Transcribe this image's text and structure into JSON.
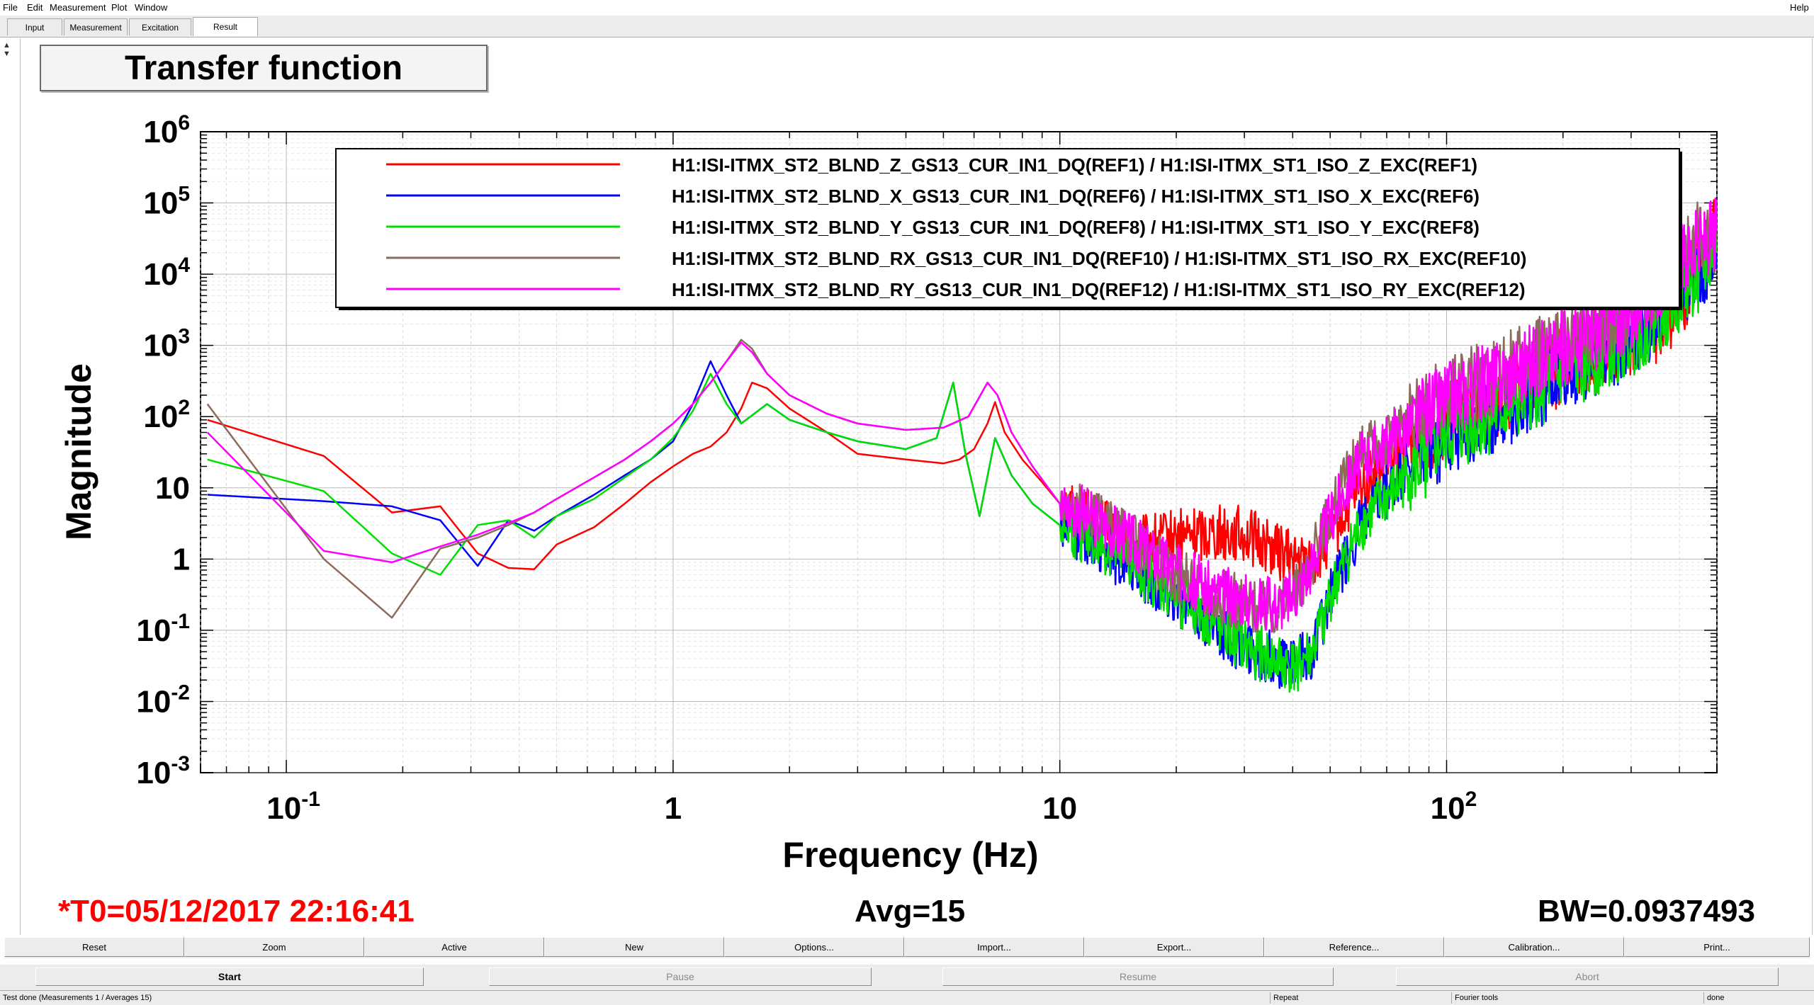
{
  "menu": {
    "file": "File",
    "edit": "Edit",
    "measurement": "Measurement",
    "plot": "Plot",
    "window": "Window",
    "help": "Help"
  },
  "tabs": [
    "Input",
    "Measurement",
    "Excitation",
    "Result"
  ],
  "active_tab": "Result",
  "plot_title": "Transfer function",
  "info": {
    "t0": "*T0=05/12/2017 22:16:41",
    "avg": "Avg=15",
    "bw": "BW=0.0937493"
  },
  "buttons": [
    "Reset",
    "Zoom",
    "Active",
    "New",
    "Options...",
    "Import...",
    "Export...",
    "Reference...",
    "Calibration...",
    "Print..."
  ],
  "run_buttons": [
    "Start",
    "Pause",
    "Resume",
    "Abort"
  ],
  "status": {
    "message": "Test done (Measurements 1 / Averages 15)",
    "repeat": "Repeat",
    "tool": "Fourier tools",
    "state": "done"
  },
  "colors": {
    "accent_red": "#ff0000",
    "series_red": "#ff0000",
    "series_blue": "#0000ff",
    "series_green": "#00e000",
    "series_brown": "#8c6a5c",
    "series_magenta": "#ff00ff"
  },
  "chart_data": {
    "type": "line",
    "xscale": "log",
    "yscale": "log",
    "xlim": [
      0.06,
      500
    ],
    "ylim": [
      0.001,
      1000000
    ],
    "xlabel": "Frequency (Hz)",
    "ylabel": "Magnitude",
    "xticks": [
      0.1,
      1,
      10,
      100
    ],
    "xtick_labels": [
      {
        "base": "10",
        "exp": "-1"
      },
      {
        "base": "1",
        "exp": ""
      },
      {
        "base": "10",
        "exp": ""
      },
      {
        "base": "10",
        "exp": "2"
      }
    ],
    "yticks": [
      0.001,
      0.01,
      0.1,
      1,
      10,
      100,
      1000,
      10000,
      100000,
      1000000
    ],
    "ytick_labels": [
      {
        "base": "10",
        "exp": "-3"
      },
      {
        "base": "10",
        "exp": "-2"
      },
      {
        "base": "10",
        "exp": "-1"
      },
      {
        "base": "1",
        "exp": ""
      },
      {
        "base": "10",
        "exp": ""
      },
      {
        "base": "10",
        "exp": "2"
      },
      {
        "base": "10",
        "exp": "3"
      },
      {
        "base": "10",
        "exp": "4"
      },
      {
        "base": "10",
        "exp": "5"
      },
      {
        "base": "10",
        "exp": "6"
      }
    ],
    "grid": true,
    "legend_position": "top",
    "series": [
      {
        "name": "H1:ISI-ITMX_ST2_BLND_Z_GS13_CUR_IN1_DQ(REF1) / H1:ISI-ITMX_ST1_ISO_Z_EXC(REF1)",
        "color": "#ff0000",
        "x": [
          0.0625,
          0.125,
          0.1875,
          0.25,
          0.3125,
          0.375,
          0.4375,
          0.5,
          0.625,
          0.75,
          0.875,
          1.0,
          1.125,
          1.25,
          1.375,
          1.5,
          1.6,
          1.75,
          2.0,
          2.5,
          3.0,
          4.0,
          5.0,
          5.5,
          6.0,
          6.5,
          6.8,
          7.2,
          8.0,
          9.0,
          10.0,
          12.0,
          15.0,
          20.0,
          25.0,
          30.0,
          35.0,
          40.0,
          45.0,
          50.0,
          60.0,
          80.0,
          100.0,
          150.0,
          200.0,
          300.0,
          400.0,
          450.0,
          500.0
        ],
        "y": [
          90,
          28,
          4.5,
          5.5,
          1.2,
          0.75,
          0.72,
          1.6,
          2.8,
          6,
          12,
          20,
          30,
          38,
          60,
          130,
          300,
          250,
          130,
          60,
          30,
          25,
          22,
          25,
          35,
          80,
          160,
          60,
          25,
          12,
          6,
          4,
          1.5,
          2,
          2.5,
          2.2,
          1.5,
          1,
          0.8,
          2,
          10,
          40,
          80,
          250,
          500,
          1200,
          3000,
          20000,
          50000
        ]
      },
      {
        "name": "H1:ISI-ITMX_ST2_BLND_X_GS13_CUR_IN1_DQ(REF6) / H1:ISI-ITMX_ST1_ISO_X_EXC(REF6)",
        "color": "#0000ff",
        "x": [
          0.0625,
          0.125,
          0.1875,
          0.25,
          0.3125,
          0.375,
          0.4375,
          0.5,
          0.625,
          0.75,
          0.875,
          1.0,
          1.125,
          1.25,
          1.375,
          1.5,
          1.75,
          2.0,
          2.5,
          3.0,
          4.0,
          4.8,
          5.3,
          5.7,
          6.2,
          6.8,
          7.5,
          8.5,
          10.0,
          12.0,
          15.0,
          20.0,
          25.0,
          30.0,
          35.0,
          40.0,
          45.0,
          50.0,
          60.0,
          80.0,
          100.0,
          150.0,
          200.0,
          300.0,
          400.0,
          500.0
        ],
        "y": [
          8,
          6.5,
          5.5,
          3.5,
          0.8,
          3.5,
          2.5,
          4,
          8,
          15,
          25,
          45,
          150,
          600,
          200,
          80,
          150,
          90,
          60,
          45,
          35,
          50,
          300,
          30,
          4,
          50,
          15,
          6,
          3,
          2,
          0.8,
          0.3,
          0.12,
          0.06,
          0.04,
          0.03,
          0.05,
          0.3,
          3,
          20,
          50,
          150,
          400,
          1200,
          5000,
          20000
        ]
      },
      {
        "name": "H1:ISI-ITMX_ST2_BLND_Y_GS13_CUR_IN1_DQ(REF8) / H1:ISI-ITMX_ST1_ISO_Y_EXC(REF8)",
        "color": "#00e000",
        "x": [
          0.0625,
          0.125,
          0.1875,
          0.25,
          0.3125,
          0.375,
          0.4375,
          0.5,
          0.625,
          0.75,
          0.875,
          1.0,
          1.125,
          1.25,
          1.375,
          1.5,
          1.75,
          2.0,
          2.5,
          3.0,
          4.0,
          4.8,
          5.3,
          5.7,
          6.2,
          6.8,
          7.5,
          8.5,
          10.0,
          12.0,
          15.0,
          20.0,
          25.0,
          30.0,
          35.0,
          40.0,
          45.0,
          50.0,
          60.0,
          80.0,
          100.0,
          150.0,
          200.0,
          300.0,
          400.0,
          500.0
        ],
        "y": [
          25,
          9,
          1.2,
          0.6,
          3,
          3.5,
          2,
          4,
          7,
          14,
          25,
          50,
          120,
          400,
          150,
          80,
          150,
          90,
          60,
          45,
          35,
          50,
          300,
          30,
          4,
          50,
          15,
          6,
          3,
          2,
          0.9,
          0.3,
          0.12,
          0.06,
          0.04,
          0.03,
          0.05,
          0.3,
          3,
          15,
          50,
          150,
          400,
          1200,
          5000,
          20000
        ]
      },
      {
        "name": "H1:ISI-ITMX_ST2_BLND_RX_GS13_CUR_IN1_DQ(REF10) / H1:ISI-ITMX_ST1_ISO_RX_EXC(REF10)",
        "color": "#8c6a5c",
        "x": [
          0.0625,
          0.125,
          0.1875,
          0.25,
          0.3125,
          0.375,
          0.4375,
          0.5,
          0.625,
          0.75,
          0.875,
          1.0,
          1.125,
          1.25,
          1.375,
          1.5,
          1.6,
          1.75,
          2.0,
          2.5,
          3.0,
          4.0,
          5.0,
          5.8,
          6.5,
          6.9,
          7.5,
          8.5,
          10.0,
          12.0,
          15.0,
          20.0,
          25.0,
          30.0,
          35.0,
          40.0,
          45.0,
          50.0,
          60.0,
          80.0,
          100.0,
          150.0,
          200.0,
          300.0,
          400.0,
          500.0
        ],
        "y": [
          150,
          1,
          0.15,
          1.4,
          2,
          3,
          4.5,
          7,
          14,
          25,
          45,
          80,
          150,
          300,
          600,
          1200,
          900,
          400,
          200,
          110,
          80,
          65,
          70,
          100,
          300,
          200,
          60,
          20,
          6,
          4,
          2,
          0.6,
          0.3,
          0.25,
          0.2,
          0.3,
          1,
          5,
          30,
          80,
          200,
          500,
          1000,
          3000,
          20000,
          50000
        ]
      },
      {
        "name": "H1:ISI-ITMX_ST2_BLND_RY_GS13_CUR_IN1_DQ(REF12) / H1:ISI-ITMX_ST1_ISO_RY_EXC(REF12)",
        "color": "#ff00ff",
        "x": [
          0.0625,
          0.125,
          0.1875,
          0.25,
          0.3125,
          0.375,
          0.4375,
          0.5,
          0.625,
          0.75,
          0.875,
          1.0,
          1.125,
          1.25,
          1.375,
          1.5,
          1.6,
          1.75,
          2.0,
          2.5,
          3.0,
          4.0,
          5.0,
          5.8,
          6.5,
          6.9,
          7.5,
          8.5,
          10.0,
          12.0,
          15.0,
          20.0,
          25.0,
          30.0,
          35.0,
          40.0,
          45.0,
          50.0,
          60.0,
          80.0,
          100.0,
          150.0,
          200.0,
          300.0,
          400.0,
          500.0
        ],
        "y": [
          60,
          1.3,
          0.9,
          1.5,
          2.2,
          3.2,
          4.5,
          7,
          14,
          25,
          45,
          80,
          150,
          300,
          600,
          1100,
          800,
          400,
          200,
          110,
          80,
          65,
          70,
          100,
          300,
          200,
          60,
          20,
          6,
          4,
          2,
          0.7,
          0.35,
          0.28,
          0.22,
          0.3,
          0.9,
          4,
          25,
          70,
          180,
          450,
          900,
          2800,
          15000,
          40000
        ]
      }
    ]
  }
}
